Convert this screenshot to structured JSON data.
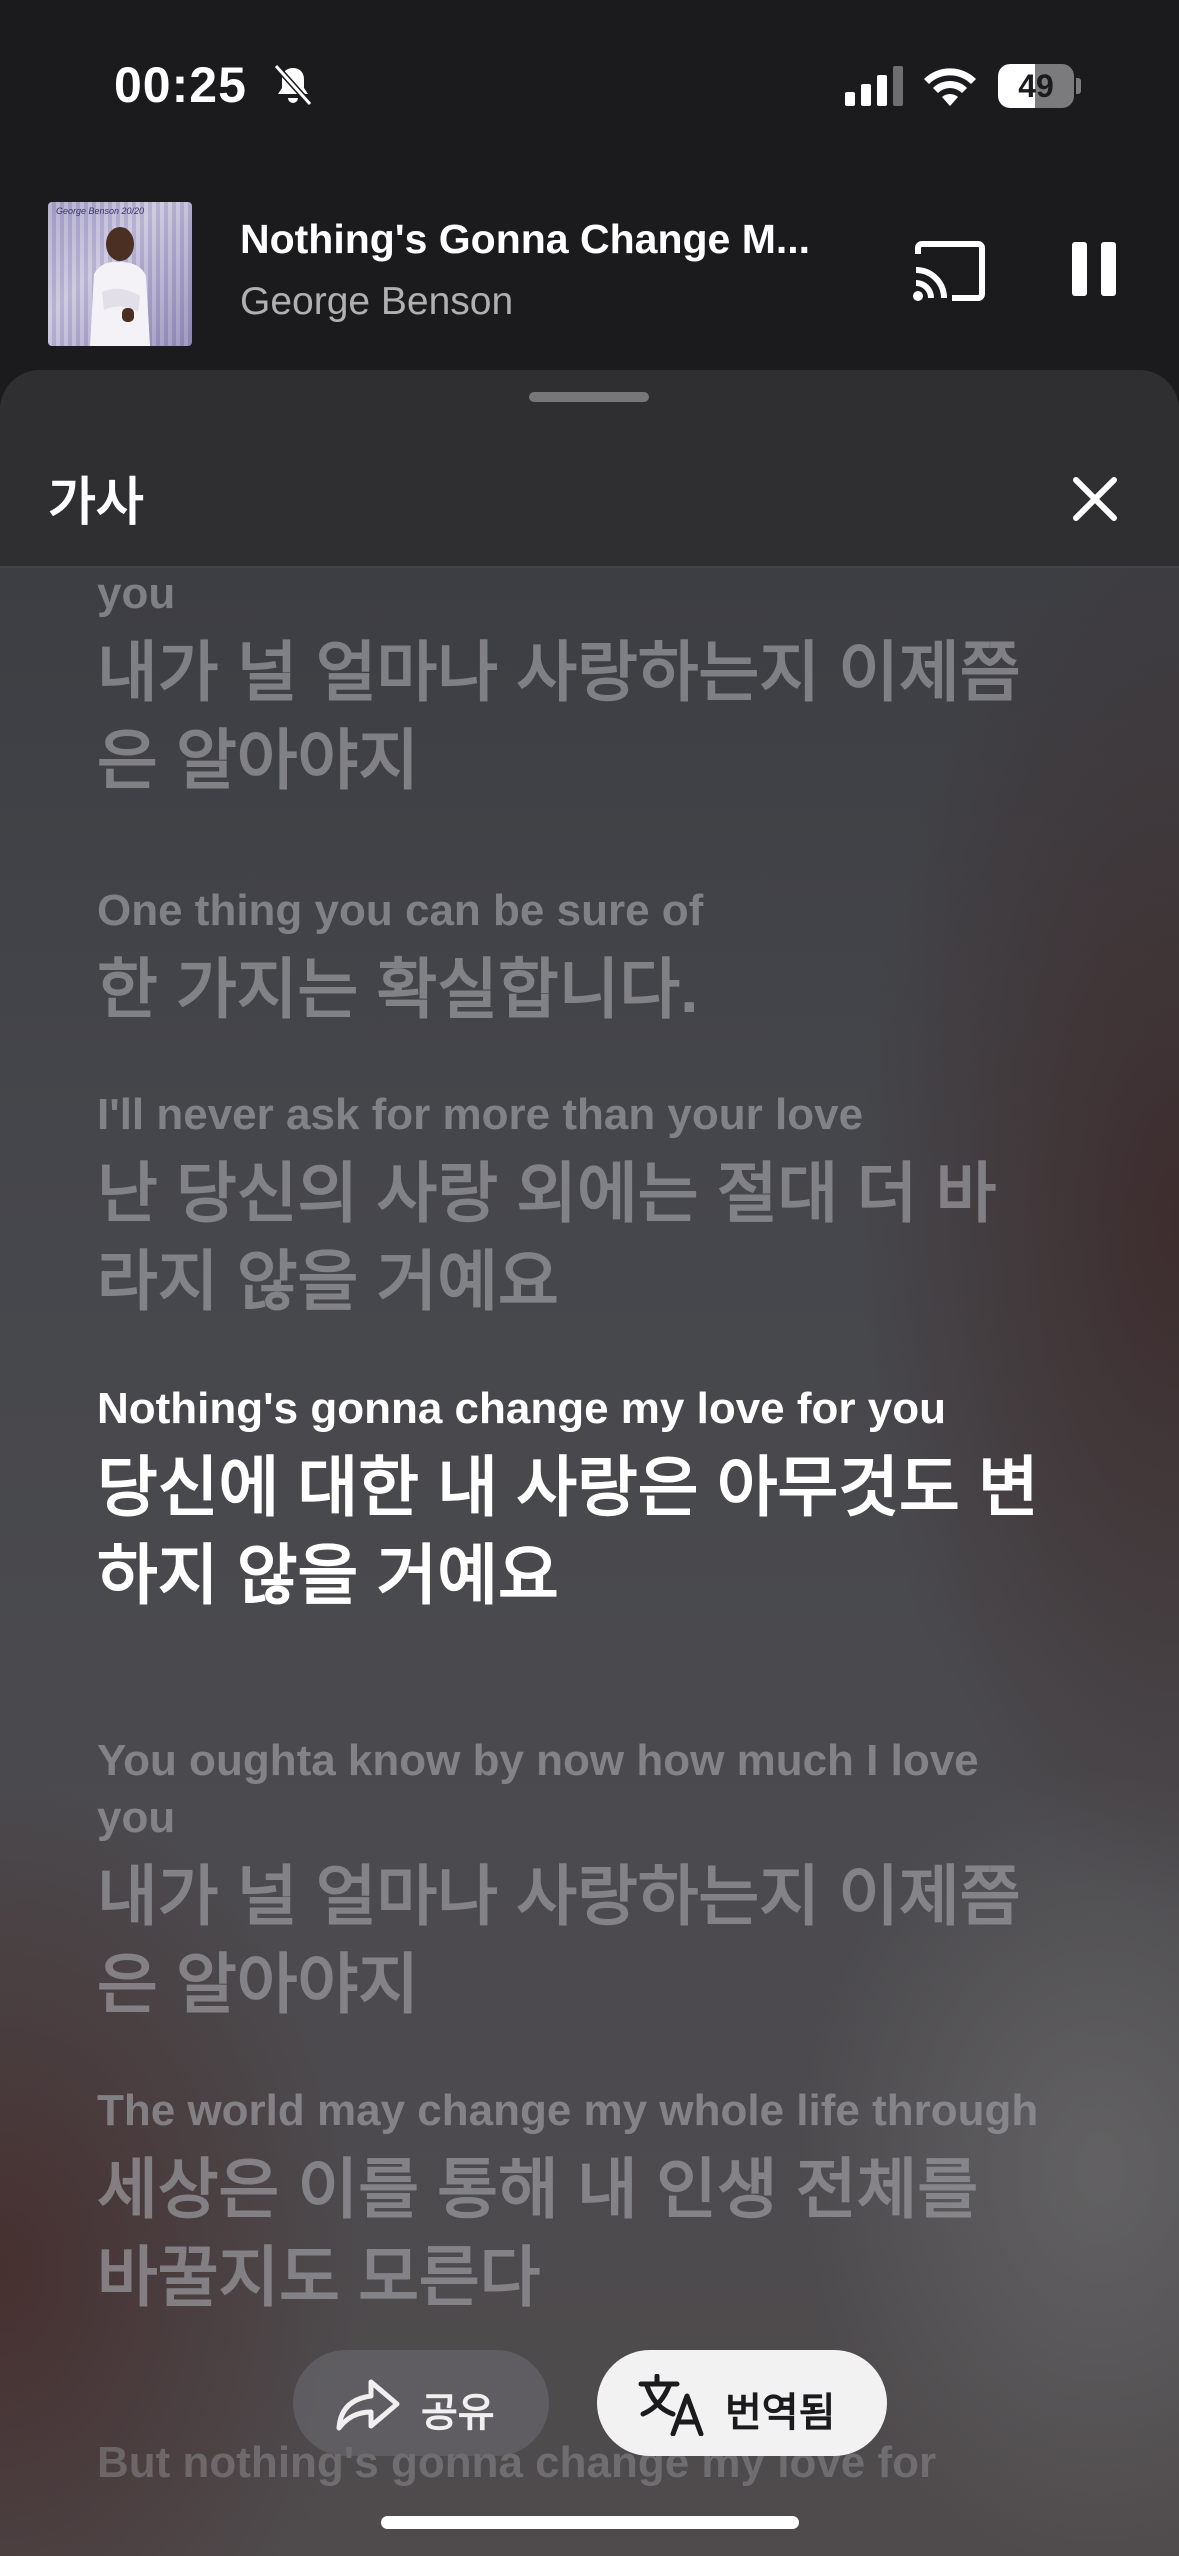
{
  "status_bar": {
    "time": "00:25",
    "battery_percent": "49",
    "battery_level": 0.49
  },
  "now_playing": {
    "title": "Nothing's Gonna Change M...",
    "artist": "George Benson",
    "album_art_text": "George Benson 20/20"
  },
  "sheet": {
    "title": "가사"
  },
  "lyrics": [
    {
      "en": "You oughta know by now how much I love you",
      "ko": "내가 널 얼마나 사랑하는지 이제쯤은 알아야지",
      "state": "partial"
    },
    {
      "en": "One thing you can be sure of",
      "ko": "한 가지는 확실합니다.",
      "state": "inactive"
    },
    {
      "en": "I'll never ask for more than your love",
      "ko": "난 당신의 사랑 외에는 절대 더 바라지 않을 거예요",
      "state": "inactive"
    },
    {
      "en": "Nothing's gonna change my love for you",
      "ko": "당신에 대한 내 사랑은 아무것도 변하지 않을 거예요",
      "state": "active"
    },
    {
      "en": "You oughta know by now how much I love you",
      "ko": "내가 널 얼마나 사랑하는지 이제쯤은 알아야지",
      "state": "inactive"
    },
    {
      "en": "The world may change my whole life through",
      "ko": "세상은 이를 통해 내 인생 전체를 바꿀지도 모른다",
      "state": "inactive"
    },
    {
      "en": "But nothing's gonna change my love for",
      "ko": "",
      "state": "faint"
    }
  ],
  "actions": {
    "share_label": "공유",
    "translate_label": "번역됨"
  },
  "colors": {
    "active_lyric": "#ffffff",
    "inactive_lyric": "#96969b",
    "header_bg": "#2f2f32"
  }
}
